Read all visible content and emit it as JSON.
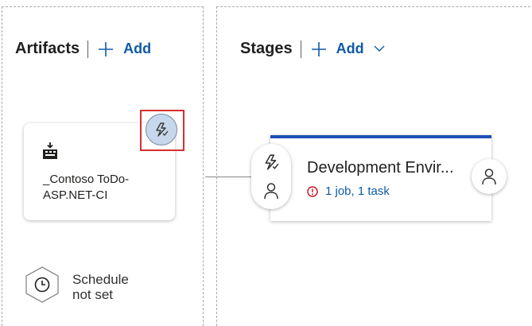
{
  "artifacts": {
    "header": "Artifacts",
    "add_label": "Add",
    "card": {
      "name_line1": "_Contoso ToDo-",
      "name_line2": "ASP.NET-CI",
      "type_icon": "build-pipeline-icon"
    },
    "trigger_icon": "lightning-check-icon",
    "schedule": {
      "icon": "clock-icon",
      "line1": "Schedule",
      "line2": "not set"
    }
  },
  "stages": {
    "header": "Stages",
    "add_label": "Add",
    "stage": {
      "title": "Development Envir...",
      "status": "1 job, 1 task",
      "status_icon": "error-circle-icon",
      "pre_deploy_icons": [
        "lightning-check-icon",
        "person-icon"
      ],
      "post_deploy_icon": "person-icon"
    }
  },
  "colors": {
    "accent": "#1e4fb5",
    "link": "#0f5aa8",
    "highlight_border": "#d62f2f",
    "trigger_fill": "#c7d7ec",
    "error": "#c50f1f"
  }
}
